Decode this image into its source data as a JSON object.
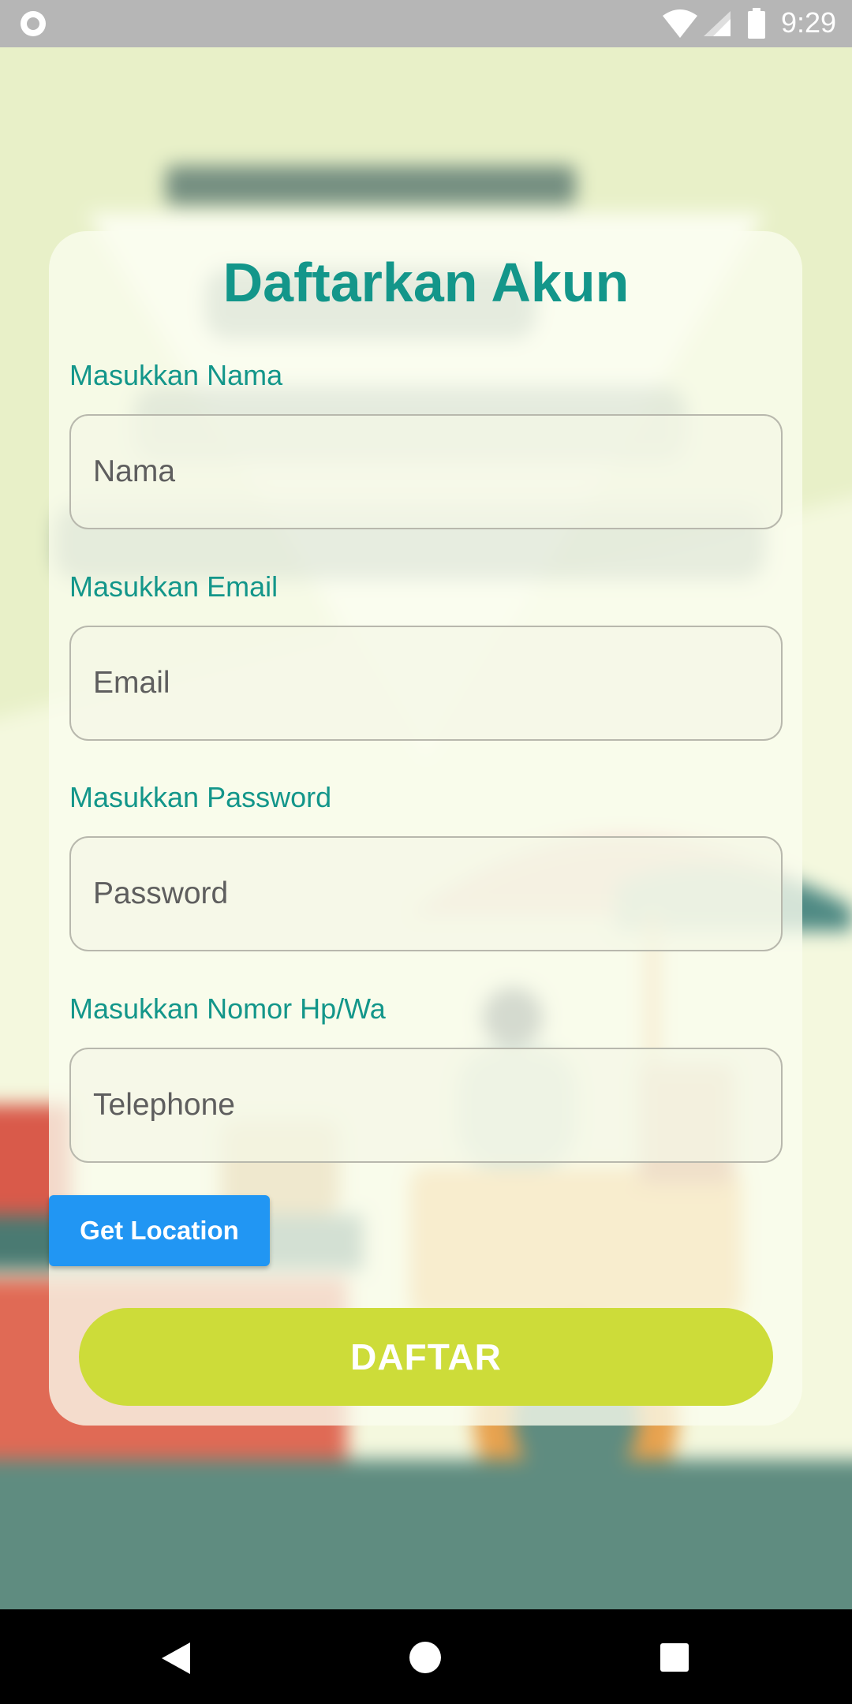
{
  "status_bar": {
    "time": "9:29",
    "icons": [
      "notification-circle-icon",
      "wifi-icon",
      "signal-icon",
      "battery-icon"
    ]
  },
  "form": {
    "title": "Daftarkan Akun",
    "fields": [
      {
        "label": "Masukkan Nama",
        "placeholder": "Nama",
        "value": ""
      },
      {
        "label": "Masukkan Email",
        "placeholder": "Email",
        "value": ""
      },
      {
        "label": "Masukkan Password",
        "placeholder": "Password",
        "value": ""
      },
      {
        "label": "Masukkan Nomor Hp/Wa",
        "placeholder": "Telephone",
        "value": ""
      }
    ],
    "get_location_label": "Get Location",
    "submit_label": "DAFTAR"
  },
  "nav_bar": {
    "icons": [
      "back-icon",
      "home-icon",
      "recent-apps-icon"
    ]
  },
  "colors": {
    "accent": "#13968a",
    "get_location_button": "#2196f3",
    "submit_button": "#cddc39",
    "status_bar": "#b6b6b6",
    "nav_bar": "#000000"
  }
}
